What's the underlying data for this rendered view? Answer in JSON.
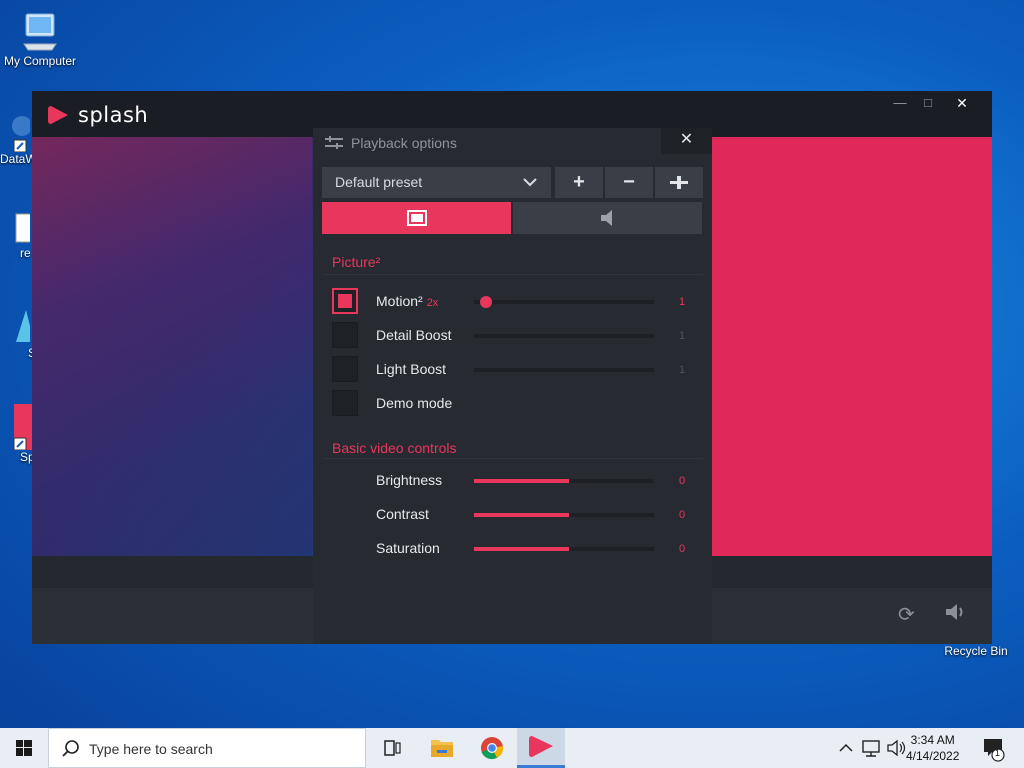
{
  "desktop": {
    "icons": [
      {
        "label": "My Computer"
      },
      {
        "label": "DataW"
      },
      {
        "label": "re"
      },
      {
        "label": "S"
      },
      {
        "label": "Sp"
      },
      {
        "label": "Recycle Bin"
      }
    ]
  },
  "window": {
    "app_name": "splash",
    "panel": {
      "title": "Playback options",
      "preset": "Default preset",
      "sections": {
        "picture": "Picture²",
        "basic": "Basic video controls"
      },
      "options": [
        {
          "label": "Motion²",
          "tag": "2x",
          "checked": true,
          "value": "1",
          "level": 0.07
        },
        {
          "label": "Detail Boost",
          "checked": false,
          "value": "1",
          "level": 0
        },
        {
          "label": "Light Boost",
          "checked": false,
          "value": "1",
          "level": 0
        },
        {
          "label": "Demo mode",
          "checked": false
        }
      ],
      "controls": [
        {
          "label": "Brightness",
          "value": "0",
          "level": 0.53
        },
        {
          "label": "Contrast",
          "value": "0",
          "level": 0.53
        },
        {
          "label": "Saturation",
          "value": "0",
          "level": 0.53
        }
      ]
    }
  },
  "taskbar": {
    "search_placeholder": "Type here to search",
    "time": "3:34 AM",
    "date": "4/14/2022",
    "notification_count": "1"
  },
  "colors": {
    "accent": "#e8365d",
    "panel_bg": "#272b31",
    "window_bg": "#1d2128",
    "desktop_blue": "#0b5fc1"
  }
}
